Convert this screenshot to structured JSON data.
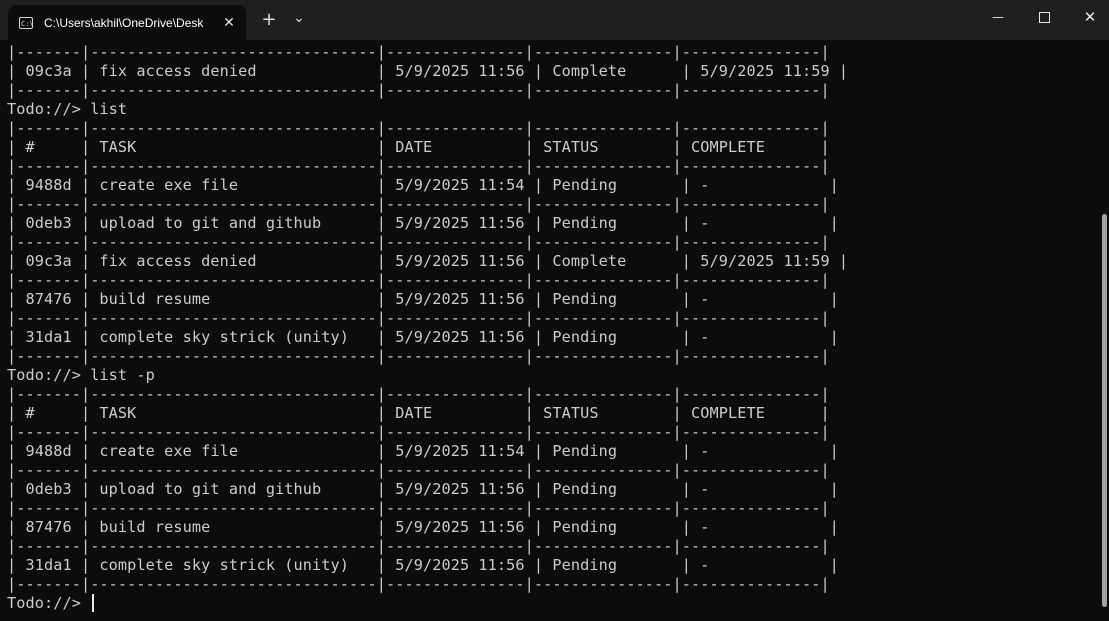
{
  "window": {
    "tab_title": "C:\\Users\\akhil\\OneDrive\\Desk",
    "tab_icon": "C:\\",
    "close_tab": "✕",
    "new_tab": "+",
    "dropdown": "⌄",
    "minimize": "—",
    "close": "✕"
  },
  "terminal": {
    "lines": [
      "|-------|-------------------------------|---------------|---------------|---------------|",
      "| 09c3a | fix access denied             | 5/9/2025 11:56 | Complete      | 5/9/2025 11:59 |",
      "|-------|-------------------------------|---------------|---------------|---------------|",
      "Todo://> list",
      "|-------|-------------------------------|---------------|---------------|---------------|",
      "| #     | TASK                          | DATE          | STATUS        | COMPLETE      |",
      "|-------|-------------------------------|---------------|---------------|---------------|",
      "| 9488d | create exe file               | 5/9/2025 11:54 | Pending       | -             |",
      "|-------|-------------------------------|---------------|---------------|---------------|",
      "| 0deb3 | upload to git and github      | 5/9/2025 11:56 | Pending       | -             |",
      "|-------|-------------------------------|---------------|---------------|---------------|",
      "| 09c3a | fix access denied             | 5/9/2025 11:56 | Complete      | 5/9/2025 11:59 |",
      "|-------|-------------------------------|---------------|---------------|---------------|",
      "| 87476 | build resume                  | 5/9/2025 11:56 | Pending       | -             |",
      "|-------|-------------------------------|---------------|---------------|---------------|",
      "| 31da1 | complete sky strick (unity)   | 5/9/2025 11:56 | Pending       | -             |",
      "|-------|-------------------------------|---------------|---------------|---------------|",
      "Todo://> list -p",
      "|-------|-------------------------------|---------------|---------------|---------------|",
      "| #     | TASK                          | DATE          | STATUS        | COMPLETE      |",
      "|-------|-------------------------------|---------------|---------------|---------------|",
      "| 9488d | create exe file               | 5/9/2025 11:54 | Pending       | -             |",
      "|-------|-------------------------------|---------------|---------------|---------------|",
      "| 0deb3 | upload to git and github      | 5/9/2025 11:56 | Pending       | -             |",
      "|-------|-------------------------------|---------------|---------------|---------------|",
      "| 87476 | build resume                  | 5/9/2025 11:56 | Pending       | -             |",
      "|-------|-------------------------------|---------------|---------------|---------------|",
      "| 31da1 | complete sky strick (unity)   | 5/9/2025 11:56 | Pending       | -             |",
      "|-------|-------------------------------|---------------|---------------|---------------|"
    ],
    "prompt": "Todo://> "
  }
}
